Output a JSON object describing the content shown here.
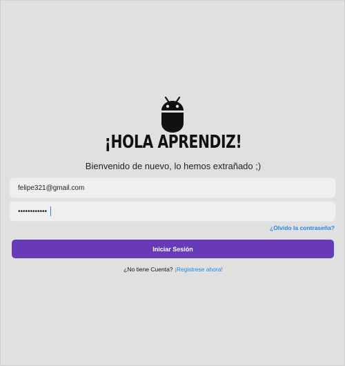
{
  "header": {
    "logo_icon": "android-icon",
    "title": "¡HOLA APRENDIZ!",
    "subtitle": "Bienvenido de nuevo, lo hemos extrañado ;)"
  },
  "form": {
    "email_value": "felipe321@gmail.com",
    "password_value": "••••••••••••",
    "forgot_label": "¿Olvido la contraseña?",
    "login_label": "Iniciar Sesión"
  },
  "footer": {
    "prompt": "¿No tiene Cuenta?",
    "register_label": "¡Registrese ahora!"
  },
  "colors": {
    "background": "#e0e0e0",
    "primary": "#673ab7",
    "link": "#1e88e5"
  }
}
